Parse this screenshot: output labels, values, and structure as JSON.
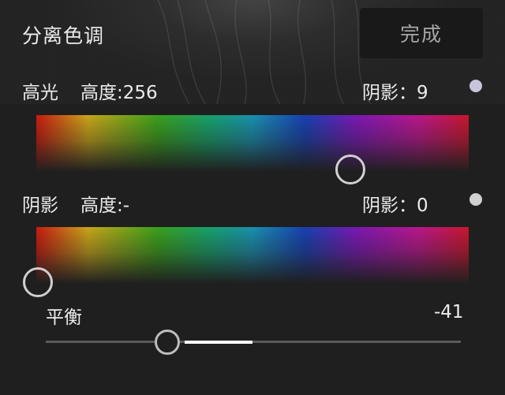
{
  "header": {
    "title": "分离色调",
    "done_label": "完成"
  },
  "highlights": {
    "label": "高光",
    "saturation_label": "高度:256",
    "shadow_label": "阴影：9",
    "indicator_color": "#c8c4dc"
  },
  "shadows": {
    "label": "阴影",
    "saturation_label": "高度:-",
    "shadow_label": "阴影：0",
    "indicator_color": "#d0d0d0"
  },
  "balance": {
    "label": "平衡",
    "value": "-41"
  }
}
